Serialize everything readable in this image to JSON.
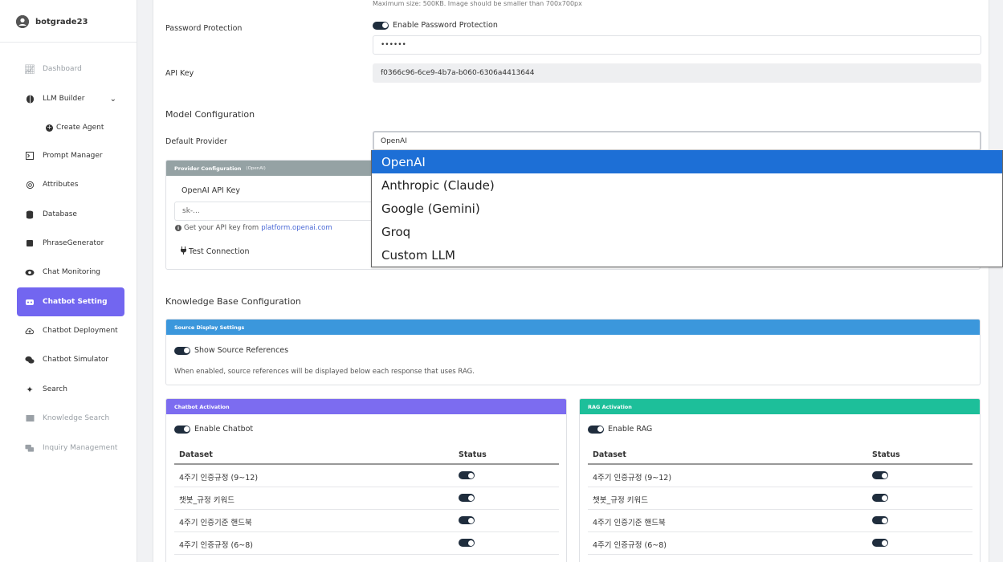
{
  "user": {
    "name": "botgrade23"
  },
  "sidebar": {
    "items": [
      {
        "label": "Dashboard",
        "icon": "chart-line-icon",
        "muted": true
      },
      {
        "label": "LLM Builder",
        "icon": "brain-icon",
        "muted": false,
        "expanded": true
      },
      {
        "label": "Prompt Manager",
        "icon": "terminal-icon",
        "muted": false
      },
      {
        "label": "Attributes",
        "icon": "fingerprint-icon",
        "muted": false
      },
      {
        "label": "Database",
        "icon": "database-icon",
        "muted": false
      },
      {
        "label": "PhraseGenerator",
        "icon": "magic-icon",
        "muted": false
      },
      {
        "label": "Chat Monitoring",
        "icon": "eye-icon",
        "muted": false
      },
      {
        "label": "Chatbot Setting",
        "icon": "robot-icon",
        "active": true
      },
      {
        "label": "Chatbot Deployment",
        "icon": "cloud-upload-icon",
        "muted": false
      },
      {
        "label": "Chatbot Simulator",
        "icon": "chat-bubbles-icon",
        "muted": false
      },
      {
        "label": "Search",
        "icon": "sparkle-icon",
        "muted": false
      },
      {
        "label": "Knowledge Search",
        "icon": "book-icon",
        "muted": true
      },
      {
        "label": "Inquiry Management",
        "icon": "comments-icon",
        "muted": true
      }
    ],
    "sub_items": [
      {
        "label": "Create Agent",
        "icon": "plus-circle-icon"
      }
    ]
  },
  "main": {
    "image_hint": "Maximum size: 500KB. Image should be smaller than 700x700px",
    "password_protection": {
      "label": "Password Protection",
      "toggle_label": "Enable Password Protection",
      "enabled": true,
      "value": "••••••"
    },
    "api_key": {
      "label": "API Key",
      "value": "f0366c96-6ce9-4b7a-b060-6306a4413644"
    },
    "model_config": {
      "title": "Model Configuration",
      "default_provider_label": "Default Provider",
      "selected_provider": "OpenAI",
      "provider_options": [
        "OpenAI",
        "Anthropic (Claude)",
        "Google (Gemini)",
        "Groq",
        "Custom LLM"
      ],
      "provider_panel": {
        "header": "Provider Configuration",
        "header_sub": "(OpenAI)",
        "api_key_label": "OpenAI API Key",
        "api_key_placeholder": "sk-...",
        "help_text": "Get your API key from",
        "help_link": "platform.openai.com",
        "test_button": "Test Connection"
      }
    },
    "knowledge_base": {
      "title": "Knowledge Base Configuration",
      "source_panel": {
        "header": "Source Display Settings",
        "toggle_label": "Show Source References",
        "enabled": true,
        "description": "When enabled, source references will be displayed below each response that uses RAG."
      }
    },
    "chatbot_activation": {
      "header": "Chatbot Activation",
      "toggle_label": "Enable Chatbot",
      "columns": [
        "Dataset",
        "Status"
      ],
      "rows": [
        "4주기 인증규정 (9~12)",
        "챗봇_규정 키워드",
        "4주기 인증기준 핸드북",
        "4주기 인증규정 (6~8)"
      ]
    },
    "rag_activation": {
      "header": "RAG Activation",
      "toggle_label": "Enable RAG",
      "columns": [
        "Dataset",
        "Status"
      ],
      "rows": [
        "4주기 인증규정 (9~12)",
        "챗봇_규정 키워드",
        "4주기 인증기준 핸드북",
        "4주기 인증규정 (6~8)"
      ]
    }
  },
  "colors": {
    "accent": "#7266f0",
    "chatbot_header": "#7c6cf0",
    "rag_header": "#1dbf9a",
    "source_header": "#3b97dc",
    "provider_header": "#95a2a4",
    "dropdown_selected": "#1d6fd6"
  }
}
